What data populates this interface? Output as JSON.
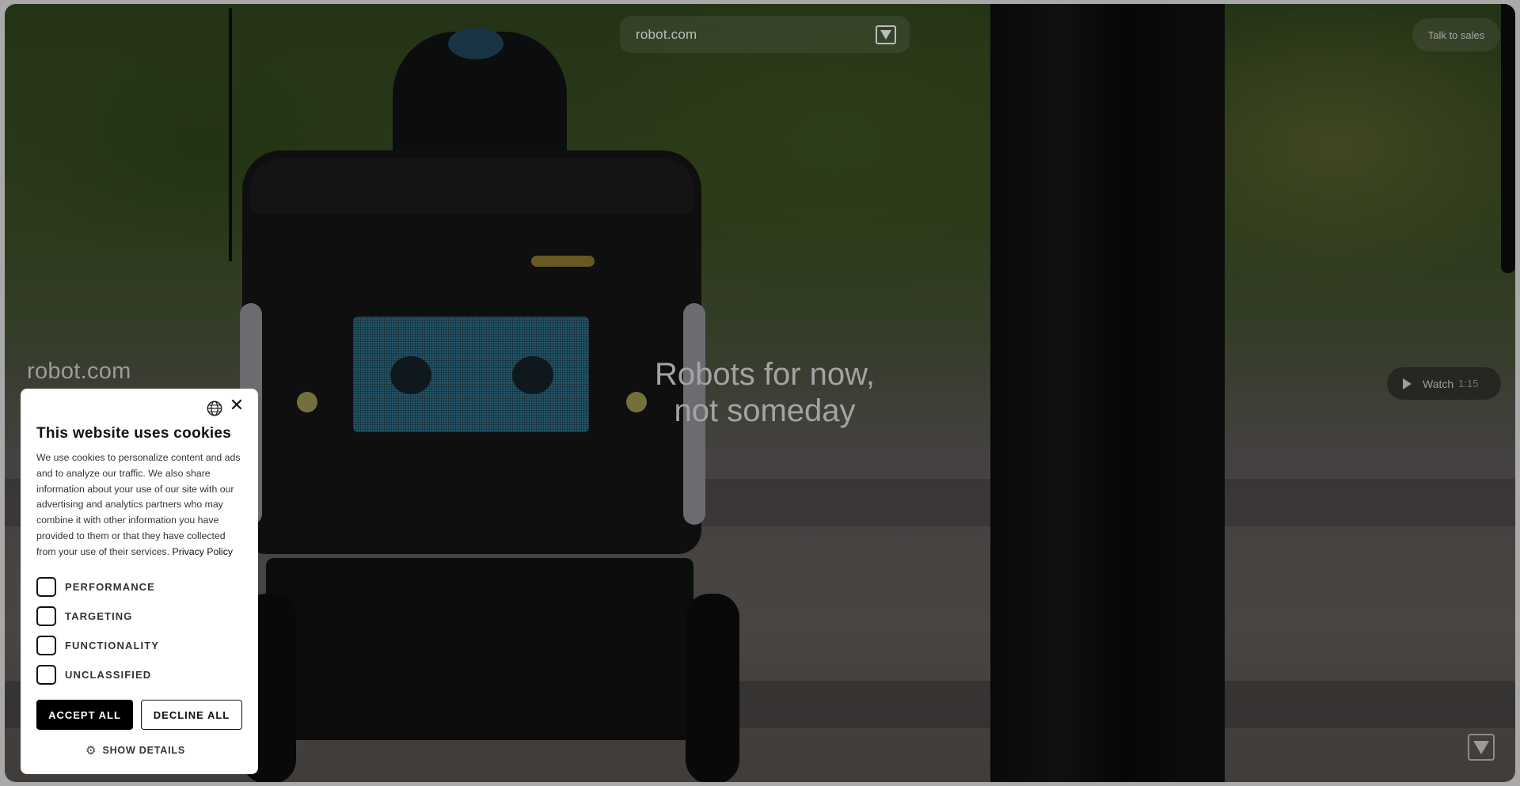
{
  "header": {
    "logo_text": "robot.com",
    "menu_icon": "triangle-down-icon",
    "talk_to_sales": "Talk to sales"
  },
  "hero": {
    "side_logo": "robot.com",
    "headline_line1": "Robots for now,",
    "headline_line2": "not someday",
    "watch_label": "Watch",
    "watch_duration": "1:15"
  },
  "cookie_dialog": {
    "title": "This website uses cookies",
    "body": "We use cookies to personalize content and ads and to analyze our traffic. We also share information about your use of our site with our advertising and analytics partners who may combine it with other information you have provided to them or that they have collected from your use of their services.",
    "privacy_link": "Privacy Policy",
    "options": [
      {
        "label": "PERFORMANCE",
        "checked": false
      },
      {
        "label": "TARGETING",
        "checked": false
      },
      {
        "label": "FUNCTIONALITY",
        "checked": false
      },
      {
        "label": "UNCLASSIFIED",
        "checked": false
      }
    ],
    "accept_all": "ACCEPT ALL",
    "decline_all": "DECLINE ALL",
    "show_details": "SHOW DETAILS"
  },
  "colors": {
    "overlay": "#000000",
    "button_primary": "#000000",
    "dialog_bg": "#ffffff"
  }
}
